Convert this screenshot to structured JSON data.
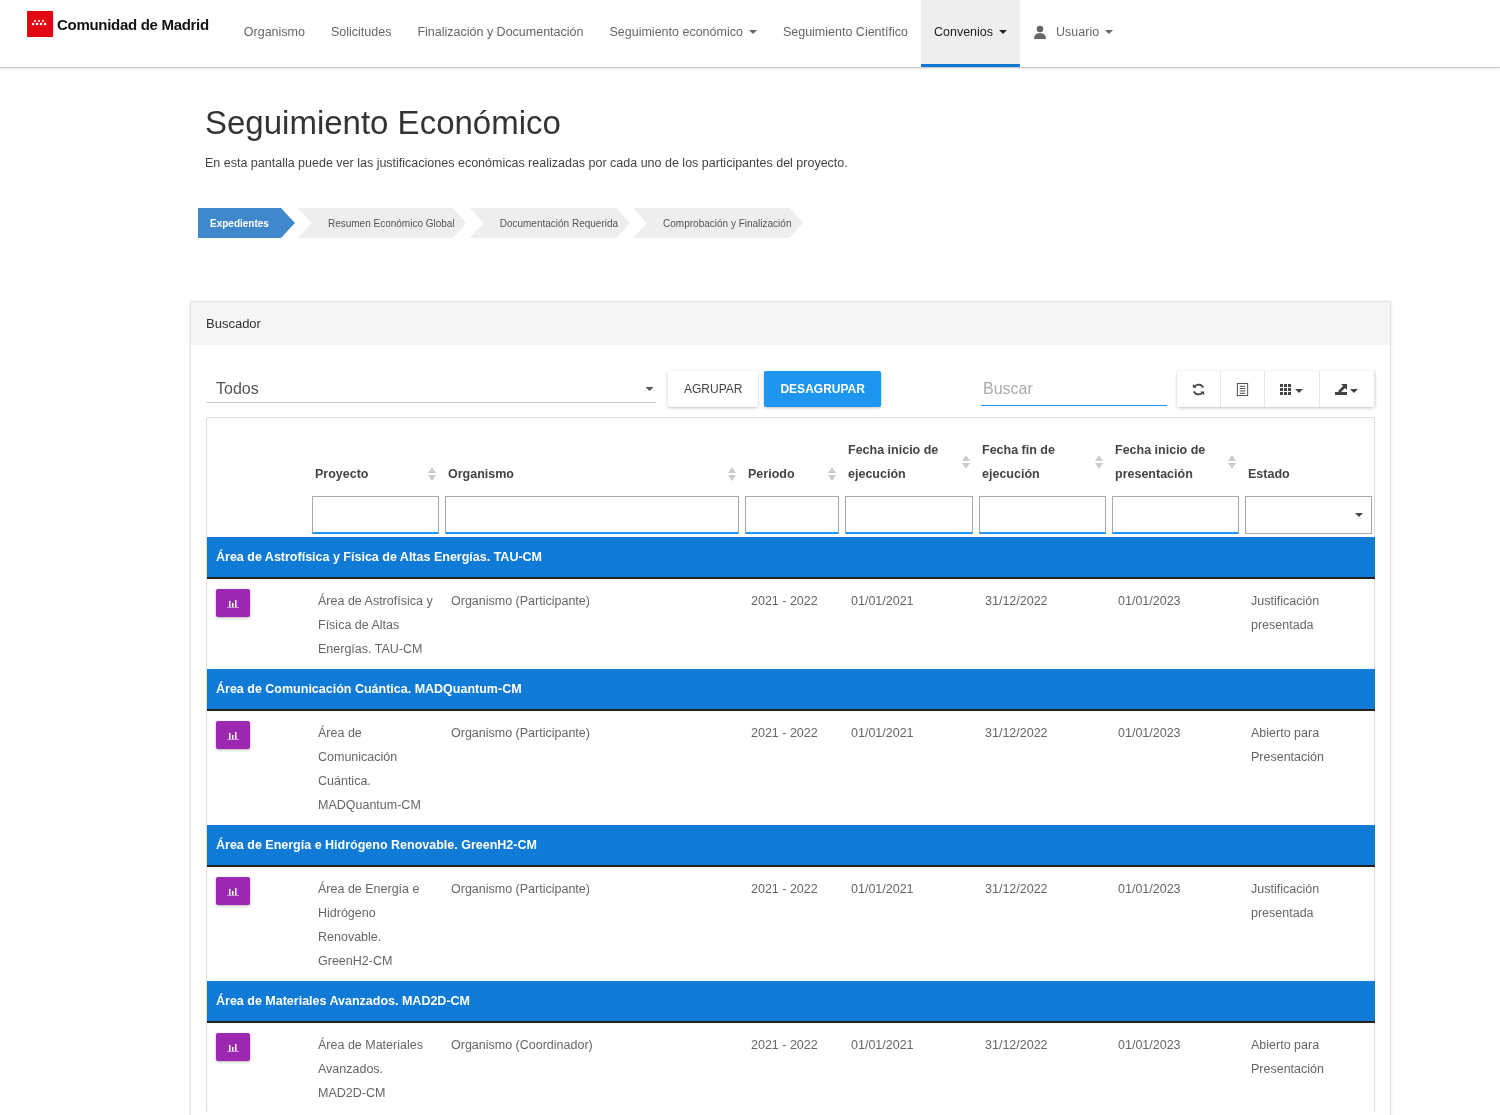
{
  "logo": {
    "text": "Comunidad de Madrid"
  },
  "nav": [
    {
      "label": "Organismo",
      "dropdown": false,
      "selected": false,
      "kind": "link"
    },
    {
      "label": "Solicitudes",
      "dropdown": false,
      "selected": false,
      "kind": "link"
    },
    {
      "label": "Finalización y Documentación",
      "dropdown": false,
      "selected": false,
      "kind": "link"
    },
    {
      "label": "Seguimiento económico",
      "dropdown": true,
      "selected": false,
      "kind": "link"
    },
    {
      "label": "Seguimiento Científico",
      "dropdown": false,
      "selected": false,
      "kind": "link"
    },
    {
      "label": "Convenios",
      "dropdown": true,
      "selected": true,
      "kind": "link"
    },
    {
      "label": "Usuario",
      "dropdown": true,
      "selected": false,
      "kind": "user"
    }
  ],
  "page": {
    "title": "Seguimiento Económico",
    "description": "En esta pantalla puede ver las justificaciones económicas realizadas por cada uno de los participantes del proyecto."
  },
  "steps": [
    {
      "label": "Expedientes",
      "selected": true
    },
    {
      "label": "Resumen Económico Global",
      "selected": false
    },
    {
      "label": "Documentación Requerida",
      "selected": false
    },
    {
      "label": "Comprobación y Finalización",
      "selected": false
    }
  ],
  "panel": {
    "title": "Buscador"
  },
  "toolbar": {
    "select_value": "Todos",
    "buttons": [
      {
        "label": "AGRUPAR",
        "selected": false
      },
      {
        "label": "DESAGRUPAR",
        "selected": true
      }
    ],
    "search_placeholder": "Buscar"
  },
  "table": {
    "columns": [
      {
        "label": "Proyecto",
        "sortable": true,
        "kind": "text"
      },
      {
        "label": "Organismo",
        "sortable": true,
        "kind": "text"
      },
      {
        "label": "Periodo",
        "sortable": true,
        "kind": "text"
      },
      {
        "label": "Fecha inicio de ejecución",
        "sortable": true,
        "kind": "text"
      },
      {
        "label": "Fecha fin de ejecución",
        "sortable": true,
        "kind": "text"
      },
      {
        "label": "Fecha inicio de presentación",
        "sortable": true,
        "kind": "text"
      },
      {
        "label": "Estado",
        "sortable": false,
        "kind": "select"
      }
    ],
    "groups": [
      {
        "title": "Área de Astrofísica y Física de Altas Energías. TAU-CM",
        "rows": [
          [
            "Área de Astrofísica y Física de Altas Energías. TAU-CM",
            "Organismo (Participante)",
            "2021 - 2022",
            "01/01/2021",
            "31/12/2022",
            "01/01/2023",
            "Justificación presentada"
          ]
        ]
      },
      {
        "title": "Área de Comunicación Cuántica. MADQuantum-CM",
        "rows": [
          [
            "Área de Comunicación Cuántica. MADQuantum-CM",
            "Organismo (Participante)",
            "2021 - 2022",
            "01/01/2021",
            "31/12/2022",
            "01/01/2023",
            "Abierto para Presentación"
          ]
        ]
      },
      {
        "title": "Área de Energía e Hidrógeno Renovable. GreenH2-CM",
        "rows": [
          [
            "Área de Energía e Hidrógeno Renovable. GreenH2-CM",
            "Organismo (Participante)",
            "2021 - 2022",
            "01/01/2021",
            "31/12/2022",
            "01/01/2023",
            "Justificación presentada"
          ]
        ]
      },
      {
        "title": "Área de Materiales Avanzados. MAD2D-CM",
        "rows": [
          [
            "Área de Materiales Avanzados. MAD2D-CM",
            "Organismo (Coordinador)",
            "2021 - 2022",
            "01/01/2021",
            "31/12/2022",
            "01/01/2023",
            "Abierto para Presentación"
          ]
        ]
      }
    ]
  }
}
